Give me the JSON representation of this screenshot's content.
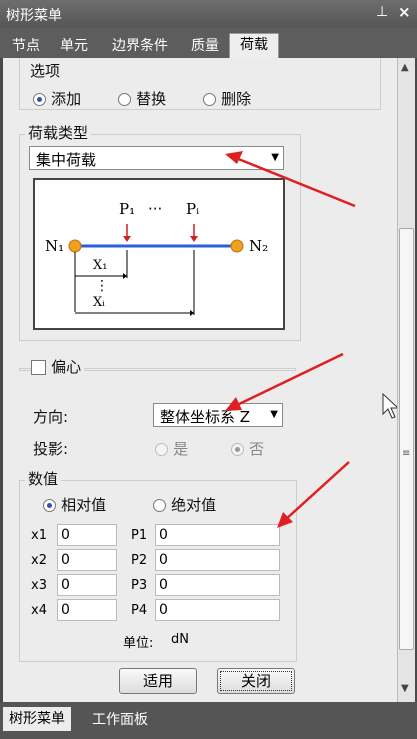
{
  "panel_title": "树形菜单",
  "titlebar_icons": {
    "pin": "pin-icon",
    "close": "close-icon"
  },
  "tabs": [
    "节点",
    "单元",
    "边界条件",
    "质量",
    "荷载"
  ],
  "active_tab": "荷载",
  "options": {
    "label": "选项",
    "add": "添加",
    "replace": "替换",
    "delete": "删除",
    "selected": "添加"
  },
  "load_type": {
    "label": "荷载类型",
    "value": "集中荷载"
  },
  "diagram": {
    "p1": "P₁",
    "dots": "···",
    "pi": "Pᵢ",
    "n1": "N₁",
    "n2": "N₂",
    "x1": "X₁",
    "vdots": "⋮",
    "xi": "Xᵢ"
  },
  "eccentric": {
    "label": "偏心",
    "checked": false
  },
  "direction": {
    "label": "方向:",
    "value": "整体坐标系 Z"
  },
  "projection": {
    "label": "投影:",
    "yes": "是",
    "no": "否",
    "selected": "否"
  },
  "values": {
    "label": "数值",
    "relative": "相对值",
    "absolute": "绝对值",
    "selected": "相对值",
    "x_fields": [
      {
        "label": "x1",
        "value": "0"
      },
      {
        "label": "x2",
        "value": "0"
      },
      {
        "label": "x3",
        "value": "0"
      },
      {
        "label": "x4",
        "value": "0"
      }
    ],
    "p_fields": [
      {
        "label": "P1",
        "value": "0"
      },
      {
        "label": "P2",
        "value": "0"
      },
      {
        "label": "P3",
        "value": "0"
      },
      {
        "label": "P4",
        "value": "0"
      }
    ],
    "unit_label": "单位:",
    "unit_value": "dN"
  },
  "buttons": {
    "apply": "适用",
    "close": "关闭"
  },
  "bottom_tabs": [
    "树形菜单",
    "工作面板"
  ],
  "colors": {
    "annotation_arrow": "#e02020",
    "beam": "#2a5fd8",
    "node": "#f0a020",
    "selected_radio": "#2a55b0"
  }
}
